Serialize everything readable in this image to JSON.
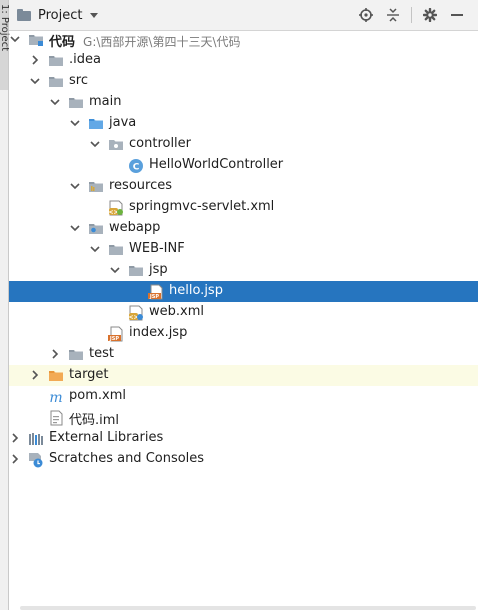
{
  "side_tab": {
    "label": "1: Project"
  },
  "header": {
    "view_title": "Project"
  },
  "tree": [
    {
      "label": "代码",
      "hint": "G:\\西部开源\\第四十三天\\代码",
      "bold": true,
      "icon": "module-folder",
      "depth": 0,
      "arrow": "down"
    },
    {
      "label": ".idea",
      "icon": "folder-gray",
      "depth": 1,
      "arrow": "right"
    },
    {
      "label": "src",
      "icon": "folder-gray",
      "depth": 1,
      "arrow": "down"
    },
    {
      "label": "main",
      "icon": "folder-gray",
      "depth": 2,
      "arrow": "down"
    },
    {
      "label": "java",
      "icon": "folder-blue",
      "depth": 3,
      "arrow": "down"
    },
    {
      "label": "controller",
      "icon": "package",
      "depth": 4,
      "arrow": "down"
    },
    {
      "label": "HelloWorldController",
      "icon": "class-c",
      "depth": 5,
      "arrow": ""
    },
    {
      "label": "resources",
      "icon": "folder-resources",
      "depth": 3,
      "arrow": "down"
    },
    {
      "label": "springmvc-servlet.xml",
      "icon": "spring-xml",
      "depth": 4,
      "arrow": ""
    },
    {
      "label": "webapp",
      "icon": "folder-web",
      "depth": 3,
      "arrow": "down"
    },
    {
      "label": "WEB-INF",
      "icon": "folder-gray",
      "depth": 4,
      "arrow": "down"
    },
    {
      "label": "jsp",
      "icon": "folder-gray",
      "depth": 5,
      "arrow": "down"
    },
    {
      "label": "hello.jsp",
      "icon": "jsp-file",
      "depth": 6,
      "arrow": "",
      "selected": true
    },
    {
      "label": "web.xml",
      "icon": "web-xml",
      "depth": 5,
      "arrow": ""
    },
    {
      "label": "index.jsp",
      "icon": "jsp-file",
      "depth": 4,
      "arrow": ""
    },
    {
      "label": "test",
      "icon": "folder-gray",
      "depth": 2,
      "arrow": "right"
    },
    {
      "label": "target",
      "icon": "folder-orange",
      "depth": 1,
      "arrow": "right",
      "excluded": true
    },
    {
      "label": "pom.xml",
      "icon": "maven-m",
      "depth": 1,
      "arrow": ""
    },
    {
      "label": "代码.iml",
      "icon": "iml-file",
      "depth": 1,
      "arrow": ""
    },
    {
      "label": "External Libraries",
      "icon": "libraries",
      "depth": 0,
      "arrow": "right"
    },
    {
      "label": "Scratches and Consoles",
      "icon": "scratches",
      "depth": 0,
      "arrow": "right"
    }
  ],
  "colors": {
    "selection": "#2675bf",
    "excluded_bg": "#fbfbe4",
    "hint": "#7a7a7a"
  }
}
